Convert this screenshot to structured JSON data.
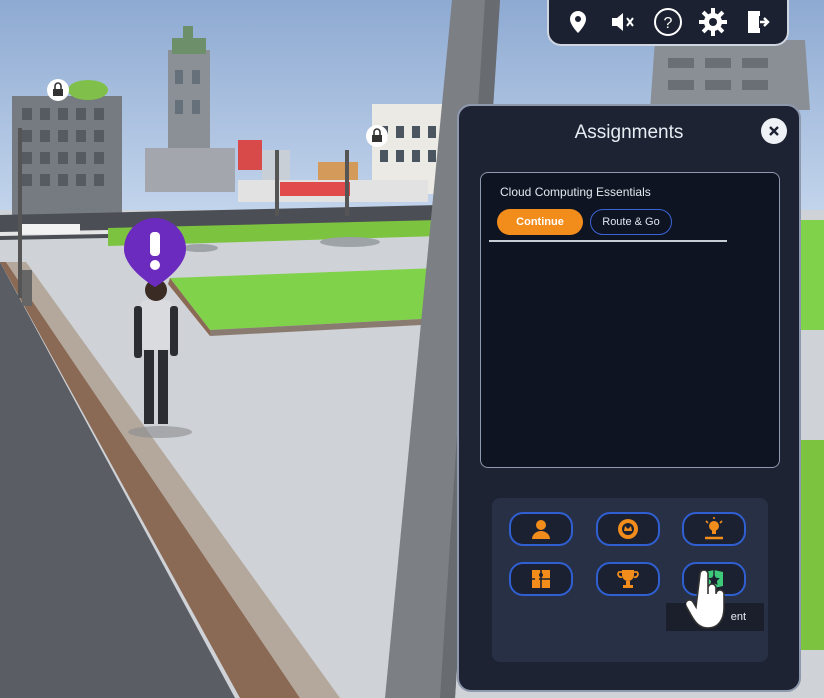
{
  "toolbar": {
    "icons": [
      "location-pin-icon",
      "mute-icon",
      "help-icon",
      "settings-icon",
      "exit-door-icon"
    ]
  },
  "panel": {
    "title": "Assignments",
    "close_icon": "close-icon",
    "course": {
      "title": "Cloud Computing Essentials",
      "continue_label": "Continue",
      "route_label": "Route & Go"
    },
    "menu_icons": [
      "profile-icon",
      "badge-icon",
      "idea-icon",
      "puzzle-icon",
      "trophy-icon",
      "assignment-icon"
    ],
    "tooltip": "ent"
  },
  "colors": {
    "accent": "#f28c1b",
    "button_border": "#2f5fd0",
    "panel_bg": "#1d2333",
    "quest_marker": "#6b2bbf"
  }
}
